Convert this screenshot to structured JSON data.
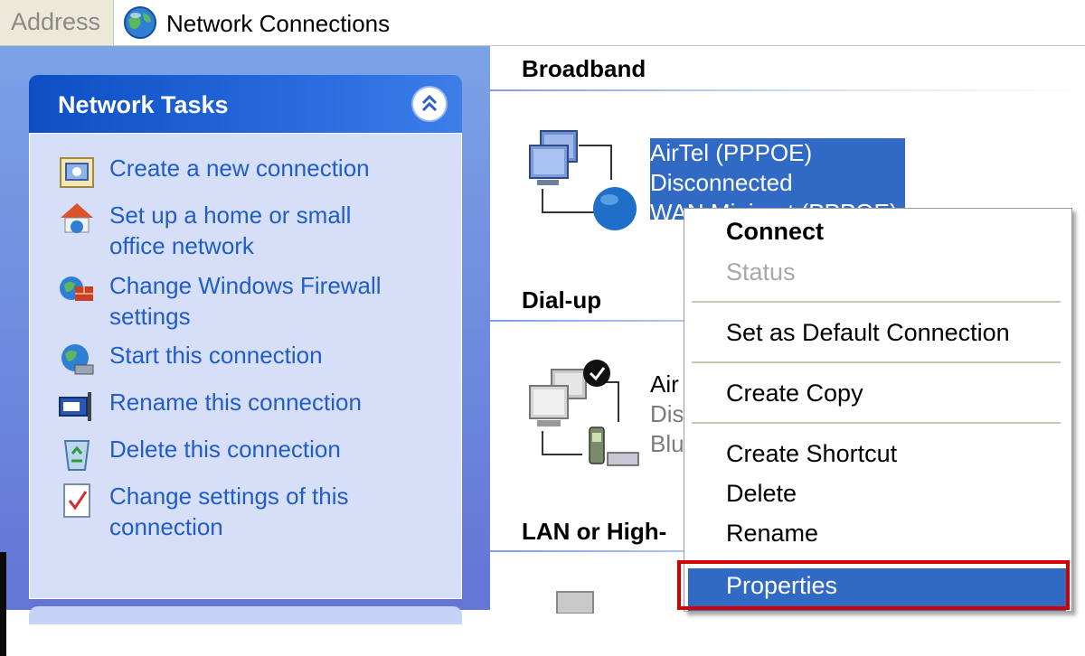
{
  "address_bar": {
    "label": "Address",
    "value": "Network Connections",
    "icon": "network-globe-icon"
  },
  "task_pane": {
    "title": "Network Tasks",
    "collapse_icon": "double-chevron-up-icon",
    "tasks": [
      {
        "label": "Create a new connection",
        "icon": "new-connection-wizard-icon"
      },
      {
        "label": "Set up a home or small office network",
        "icon": "home-network-icon"
      },
      {
        "label": "Change Windows Firewall settings",
        "icon": "firewall-icon"
      },
      {
        "label": "Start this connection",
        "icon": "globe-connection-icon"
      },
      {
        "label": "Rename this connection",
        "icon": "rename-icon"
      },
      {
        "label": "Delete this connection",
        "icon": "recycle-bin-icon"
      },
      {
        "label": "Change settings of this connection",
        "icon": "settings-document-icon"
      }
    ]
  },
  "content": {
    "groups": [
      {
        "header": "Broadband"
      },
      {
        "header": "Dial-up"
      },
      {
        "header": "LAN or High-"
      }
    ],
    "broadband_connection": {
      "name": "AirTel (PPPOE)",
      "status": "Disconnected",
      "device_partial": "WAN Miniport (PPPOE)",
      "icon": "broadband-connection-icon"
    },
    "dialup_connection": {
      "name_partial": "Air",
      "status_partial": "Dis",
      "device_partial": "Blu",
      "icon": "dialup-connection-icon"
    }
  },
  "context_menu": {
    "items": [
      {
        "label": "Connect",
        "state": "default-bold"
      },
      {
        "label": "Status",
        "state": "disabled"
      },
      {
        "label": "Set as Default Connection",
        "state": "normal"
      },
      {
        "label": "Create Copy",
        "state": "normal"
      },
      {
        "label": "Create Shortcut",
        "state": "normal"
      },
      {
        "label": "Delete",
        "state": "normal"
      },
      {
        "label": "Rename",
        "state": "normal"
      },
      {
        "label": "Properties",
        "state": "highlighted"
      }
    ],
    "highlight_color": "#316ac5",
    "annotation_color": "#d40000"
  }
}
